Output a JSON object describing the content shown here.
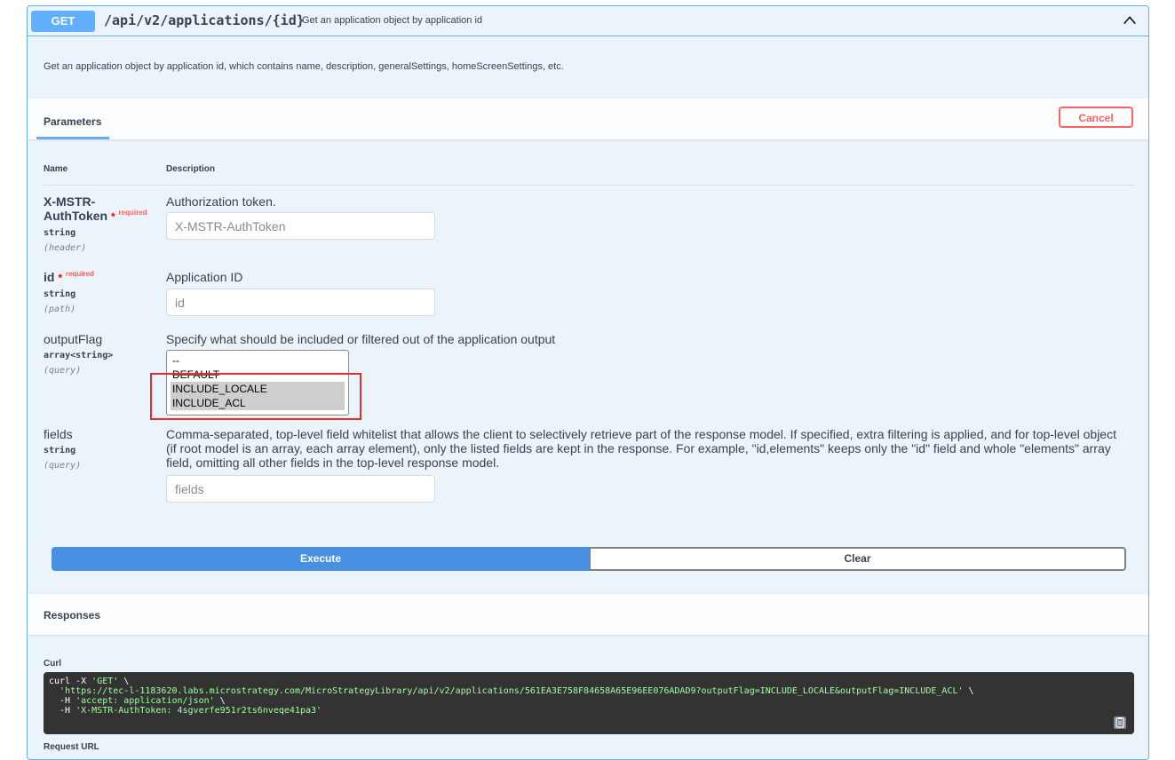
{
  "summary": {
    "method": "GET",
    "path": "/api/v2/applications/{id}",
    "description": "Get an application object by application id"
  },
  "long_description": "Get an application object by application id, which contains name, description, generalSettings, homeScreenSettings, etc.",
  "parameters": {
    "tab_label": "Parameters",
    "cancel_label": "Cancel",
    "col_name": "Name",
    "col_description": "Description",
    "required_star": "*",
    "required_label": "required",
    "items": [
      {
        "name_line1": "X-MSTR-",
        "name_line2": "AuthToken",
        "type": "string",
        "in": "(header)",
        "description": "Authorization token.",
        "placeholder": "X-MSTR-AuthToken",
        "value": ""
      },
      {
        "name": "id",
        "type": "string",
        "in": "(path)",
        "description": "Application ID",
        "placeholder": "id",
        "value": ""
      },
      {
        "name": "outputFlag",
        "type": "array<string>",
        "in": "(query)",
        "description": "Specify what should be included or filtered out of the application output",
        "options": [
          "--",
          "DEFAULT",
          "INCLUDE_LOCALE",
          "INCLUDE_ACL"
        ],
        "selected": [
          "INCLUDE_LOCALE",
          "INCLUDE_ACL"
        ]
      },
      {
        "name": "fields",
        "type": "string",
        "in": "(query)",
        "description_lines": [
          "Comma-separated, top-level field whitelist that allows the client to selectively retrieve part of the response model. If specified, extra filtering is applied, and for top-level object",
          "(if root model is an array, each array element), only the listed fields are kept in the response. For example, \"id,elements\" keeps only the \"id\" field and whole \"elements\" array",
          "field, omitting all other fields in the top-level response model."
        ],
        "placeholder": "fields",
        "value": ""
      }
    ]
  },
  "actions": {
    "execute_label": "Execute",
    "clear_label": "Clear"
  },
  "responses": {
    "title": "Responses",
    "curl_label": "Curl",
    "curl_lines": {
      "l1_cmd": "curl -X ",
      "l1_str": "'GET'",
      "l1_end": " \\",
      "l2_str": "'https://tec-l-1183620.labs.microstrategy.com/MicroStrategyLibrary/api/v2/applications/561EA3E758F84658A65E96EE076ADAD9?outputFlag=INCLUDE_LOCALE&outputFlag=INCLUDE_ACL'",
      "l2_end": " \\",
      "l3_cmd": "  -H ",
      "l3_str": "'accept: application/json'",
      "l3_end": " \\",
      "l4_cmd": "  -H ",
      "l4_str": "'X-MSTR-AuthToken: 4sgverfe951r2ts6nveqe41pa3'"
    },
    "request_url_label": "Request URL"
  },
  "colors": {
    "get_blue": "#61affe",
    "execute_blue": "#4990e2",
    "cancel_red": "#ff6060",
    "highlight_red": "#e32d2d"
  },
  "icons": {
    "collapse": "chevron-up-icon",
    "copy": "copy-to-clipboard-icon"
  }
}
